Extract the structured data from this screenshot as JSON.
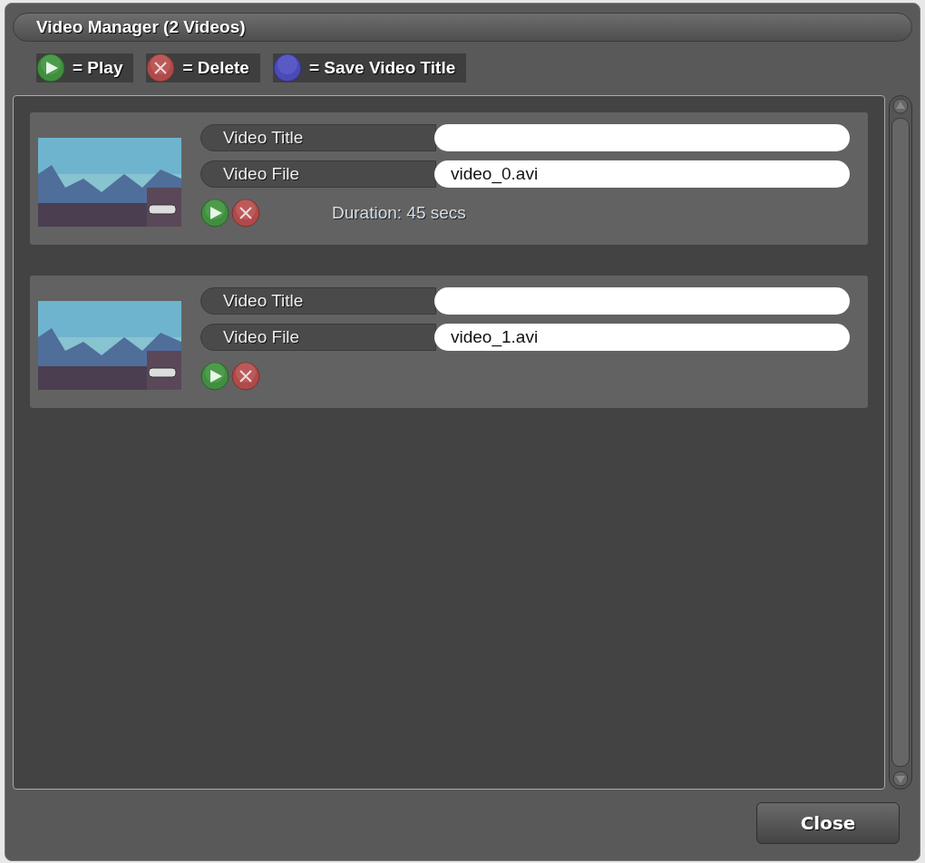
{
  "window": {
    "title": "Video Manager (2 Videos)"
  },
  "legend": [
    {
      "kind": "play",
      "label": "= Play"
    },
    {
      "kind": "delete",
      "label": "= Delete"
    },
    {
      "kind": "save",
      "label": "= Save Video Title"
    }
  ],
  "videos": [
    {
      "title_label": "Video Title",
      "file_label": "Video File",
      "file_value": "video_0.avi",
      "duration": "Duration: 45 secs"
    },
    {
      "title_label": "Video Title",
      "file_label": "Video File",
      "file_value": "video_1.avi"
    }
  ],
  "close_button": "Close"
}
